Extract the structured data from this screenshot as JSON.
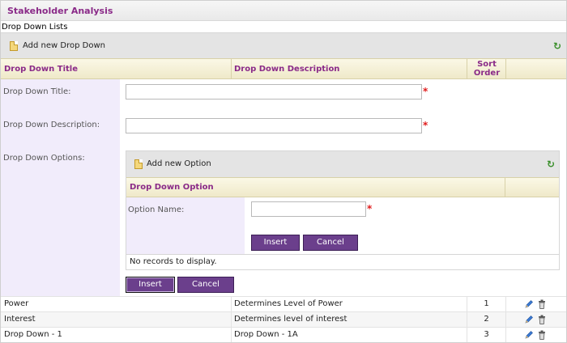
{
  "window": {
    "title": "Stakeholder Analysis"
  },
  "section_label": "Drop Down Lists",
  "command_bar": {
    "add_label": "Add new Drop Down",
    "refresh_icon": "refresh-icon"
  },
  "grid": {
    "columns": [
      "Drop Down Title",
      "Drop Down Description",
      "Sort Order",
      ""
    ]
  },
  "form": {
    "title_label": "Drop Down Title:",
    "title_value": "",
    "description_label": "Drop Down Description:",
    "description_value": "",
    "options_label": "Drop Down Options:",
    "required_mark": "*"
  },
  "options_grid": {
    "add_label": "Add new Option",
    "column": "Drop Down Option",
    "option_name_label": "Option Name:",
    "option_name_value": "",
    "insert_label": "Insert",
    "cancel_label": "Cancel",
    "no_records": "No records to display."
  },
  "form_buttons": {
    "insert_label": "Insert",
    "cancel_label": "Cancel"
  },
  "rows": [
    {
      "title": "Power",
      "description": "Determines Level of Power",
      "sort": "1"
    },
    {
      "title": "Interest",
      "description": "Determines level of interest",
      "sort": "2"
    },
    {
      "title": "Drop Down - 1",
      "description": "Drop Down - 1A",
      "sort": "3"
    }
  ],
  "colors": {
    "accent": "#8a2a88",
    "button": "#6b3f8c",
    "required": "#e01b1b",
    "label_bg": "#f1ecfb"
  }
}
